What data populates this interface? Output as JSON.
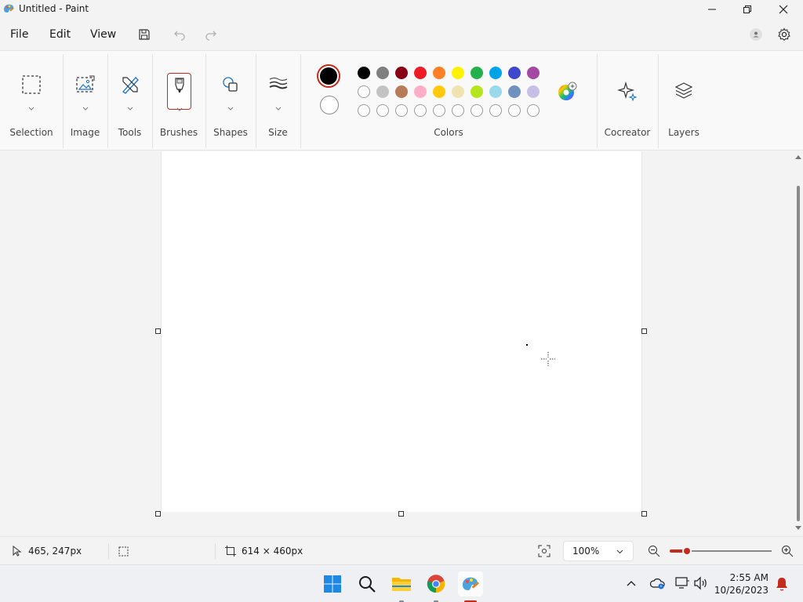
{
  "window": {
    "title": "Untitled - Paint"
  },
  "menu": {
    "file": "File",
    "edit": "Edit",
    "view": "View"
  },
  "ribbon": {
    "groups": {
      "selection": "Selection",
      "image": "Image",
      "tools": "Tools",
      "brushes": "Brushes",
      "shapes": "Shapes",
      "size": "Size",
      "colors": "Colors",
      "cocreator": "Cocreator",
      "layers": "Layers"
    },
    "primary_color": "#000000",
    "secondary_color": "#ffffff",
    "palette_row1": [
      "#000000",
      "#7f7f7f",
      "#880015",
      "#ed1c24",
      "#ff7f27",
      "#fff200",
      "#22b14c",
      "#00a2e8",
      "#3f48cc",
      "#a349a4"
    ],
    "palette_row2": [
      "#ffffff",
      "#c3c3c3",
      "#b97a57",
      "#ffaec9",
      "#ffc90e",
      "#efe4b0",
      "#b5e61d",
      "#99d9ea",
      "#7092be",
      "#c8bfe7"
    ],
    "palette_row3_count": 10
  },
  "status": {
    "cursor_pos": "465, 247px",
    "canvas_size": "614 × 460px",
    "zoom": "100%"
  },
  "taskbar": {
    "time": "2:55 AM",
    "date": "10/26/2023"
  },
  "colors": {
    "accent_red": "#c42b1c",
    "ribbon_bg": "#f9f9f9"
  }
}
